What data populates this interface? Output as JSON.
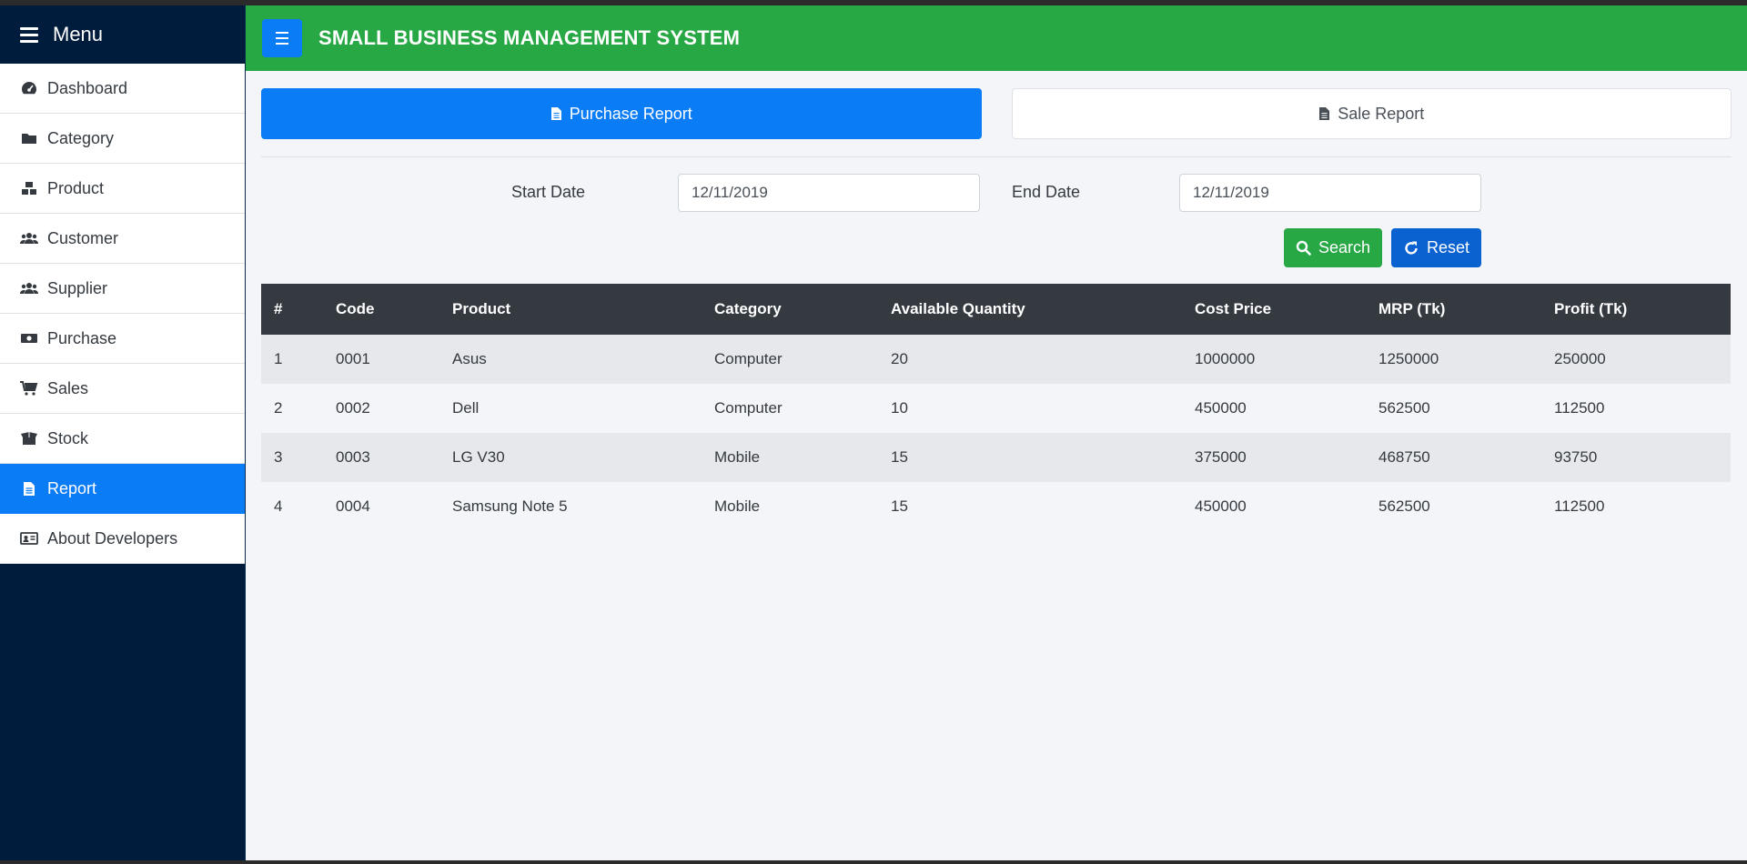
{
  "sidebar": {
    "title": "Menu",
    "items": [
      {
        "label": "Dashboard",
        "icon": "tachometer-icon"
      },
      {
        "label": "Category",
        "icon": "folder-icon"
      },
      {
        "label": "Product",
        "icon": "boxes-icon"
      },
      {
        "label": "Customer",
        "icon": "users-icon"
      },
      {
        "label": "Supplier",
        "icon": "users-icon"
      },
      {
        "label": "Purchase",
        "icon": "money-bill-icon"
      },
      {
        "label": "Sales",
        "icon": "shopping-cart-icon"
      },
      {
        "label": "Stock",
        "icon": "box-open-icon"
      },
      {
        "label": "Report",
        "icon": "file-icon",
        "active": true
      },
      {
        "label": "About Developers",
        "icon": "id-card-icon"
      }
    ]
  },
  "header": {
    "title": "SMALL BUSINESS MANAGEMENT SYSTEM"
  },
  "tabs": {
    "purchase_report": "Purchase Report",
    "sale_report": "Sale Report"
  },
  "filters": {
    "start_label": "Start Date",
    "start_value": "12/11/2019",
    "end_label": "End Date",
    "end_value": "12/11/2019",
    "search_label": "Search",
    "reset_label": "Reset"
  },
  "table": {
    "columns": [
      "#",
      "Code",
      "Product",
      "Category",
      "Available Quantity",
      "Cost Price",
      "MRP (Tk)",
      "Profit (Tk)"
    ],
    "rows": [
      [
        "1",
        "0001",
        "Asus",
        "Computer",
        "20",
        "1000000",
        "1250000",
        "250000"
      ],
      [
        "2",
        "0002",
        "Dell",
        "Computer",
        "10",
        "450000",
        "562500",
        "112500"
      ],
      [
        "3",
        "0003",
        "LG V30",
        "Mobile",
        "15",
        "375000",
        "468750",
        "93750"
      ],
      [
        "4",
        "0004",
        "Samsung Note 5",
        "Mobile",
        "15",
        "450000",
        "562500",
        "112500"
      ]
    ]
  },
  "colors": {
    "sidebar_bg": "#001c3d",
    "header_bg": "#28a745",
    "primary": "#0a7cf6",
    "table_header_bg": "#343a40"
  }
}
